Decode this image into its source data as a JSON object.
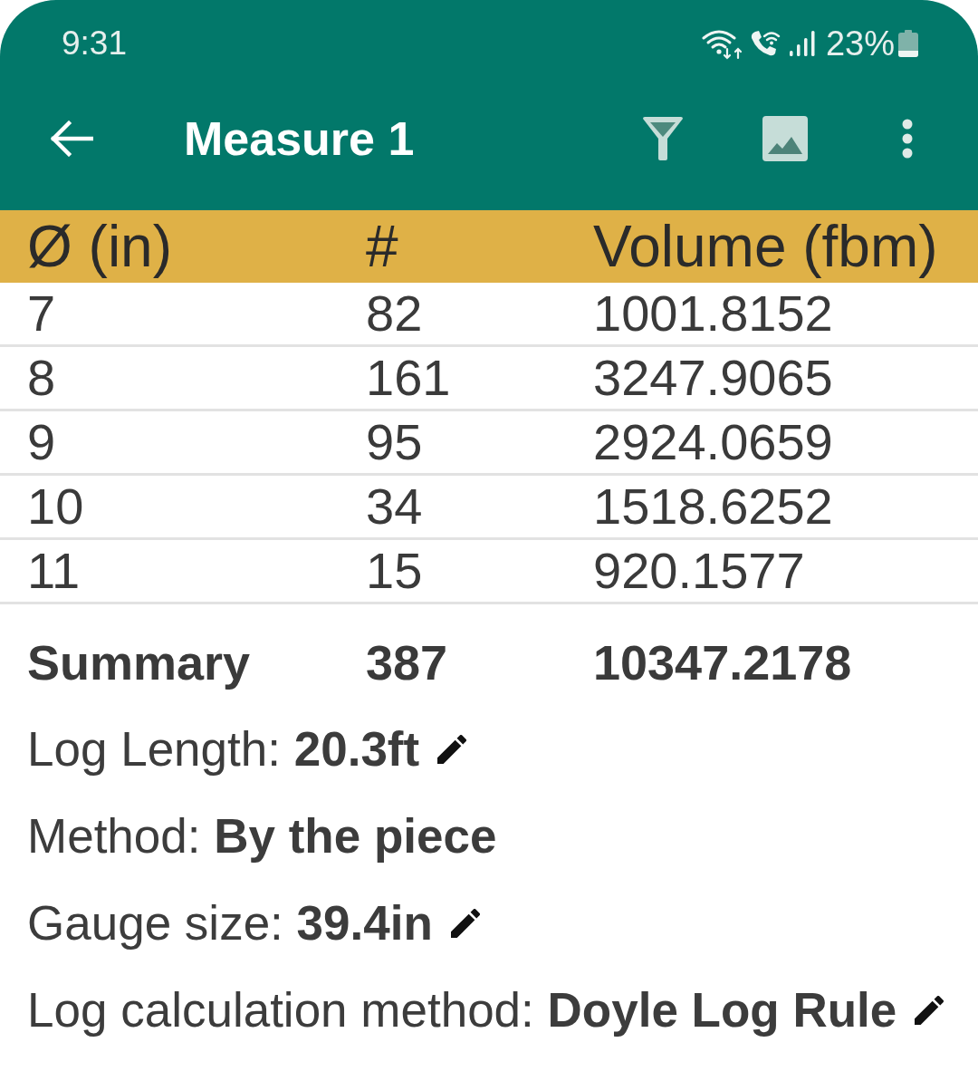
{
  "status_bar": {
    "time": "9:31",
    "battery": "23%"
  },
  "toolbar": {
    "title": "Measure 1"
  },
  "table": {
    "columns": [
      "Ø (in)",
      "#",
      "Volume (fbm)"
    ],
    "rows": [
      [
        "7",
        "82",
        "1001.8152"
      ],
      [
        "8",
        "161",
        "3247.9065"
      ],
      [
        "9",
        "95",
        "2924.0659"
      ],
      [
        "10",
        "34",
        "1518.6252"
      ],
      [
        "11",
        "15",
        "920.1577"
      ]
    ]
  },
  "summary": {
    "label": "Summary",
    "count": "387",
    "volume": "10347.2178"
  },
  "details": [
    {
      "text": "Log Length: **20.3ft**",
      "editable": true
    },
    {
      "text": "Method: **By the piece**",
      "editable": false
    },
    {
      "text": "Gauge size: **39.4in**",
      "editable": true
    },
    {
      "text": "Log calculation method: **Doyle Log Rule**",
      "editable": true
    }
  ]
}
